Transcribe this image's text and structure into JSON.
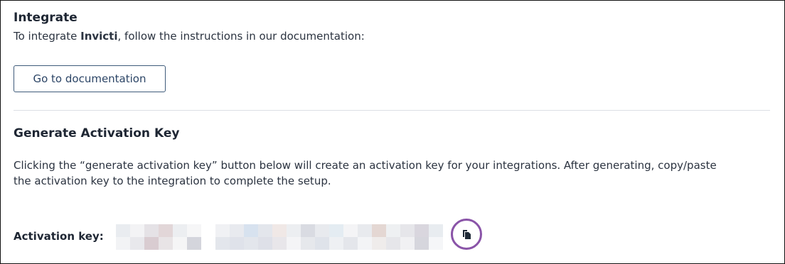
{
  "integrate": {
    "title": "Integrate",
    "text_prefix": "To integrate ",
    "product_name": "Invicti",
    "text_suffix": ", follow the instructions in our documentation:",
    "doc_button_label": "Go to documentation"
  },
  "activation": {
    "title": "Generate Activation Key",
    "description": "Clicking the “generate activation key” button below will create an activation key for your integrations. After generating, copy/paste the activation key to the integration to complete the setup.",
    "key_label": "Activation key:",
    "key_value_obscured": true,
    "copy_icon": "copy-icon",
    "copy_ring_color": "#8a54a8"
  }
}
